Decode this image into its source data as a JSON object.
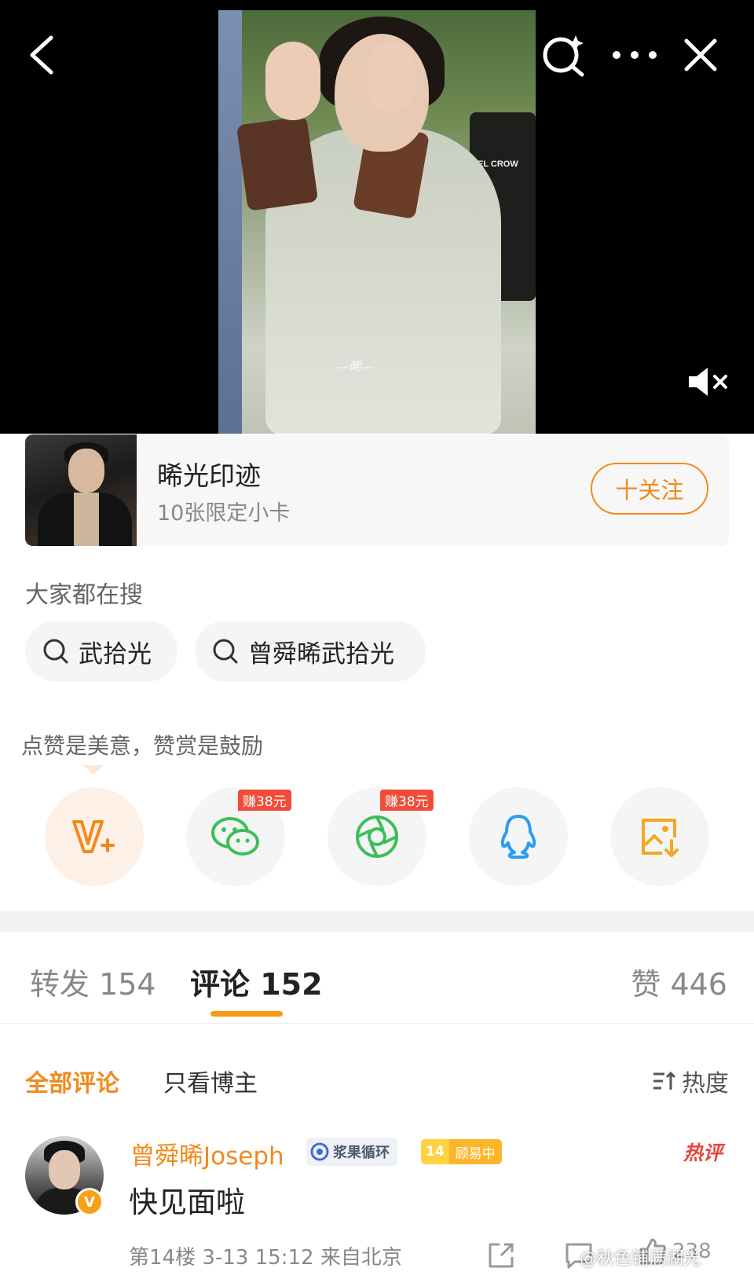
{
  "card": {
    "title": "晞光印迹",
    "subtitle": "10张限定小卡",
    "follow_label": "十关注"
  },
  "hot_search": {
    "title": "大家都在搜",
    "chips": [
      "武拾光",
      "曾舜晞武拾光"
    ]
  },
  "share": {
    "title": "点赞是美意，赞赏是鼓励",
    "earn_badge": "赚38元",
    "buttons": [
      "v-plus-icon",
      "wechat-icon",
      "moments-icon",
      "qq-icon",
      "save-image-icon"
    ]
  },
  "photo": {
    "chair_text": "EL CROW",
    "signature": "—晞—"
  },
  "tabs": {
    "repost": "转发 154",
    "comment": "评论 152",
    "like": "赞 446"
  },
  "filters": {
    "all": "全部评论",
    "owner_only": "只看博主",
    "sort": "热度"
  },
  "comment": {
    "author": "曾舜晞Joseph",
    "tag_juice": "浆果循环",
    "fan_level": "14",
    "fan_name": "顾易中",
    "hot_label": "热评",
    "text": "快见面啦",
    "meta": "第14楼 3-13 15:12 来自北京",
    "like_count": "238"
  },
  "watermark": "@秋色铺满湖光",
  "colors": {
    "accent": "#f18a1c",
    "tab_underline": "#f59b14",
    "earn_badge": "#f14c3a",
    "hot_label": "#e8453c"
  }
}
